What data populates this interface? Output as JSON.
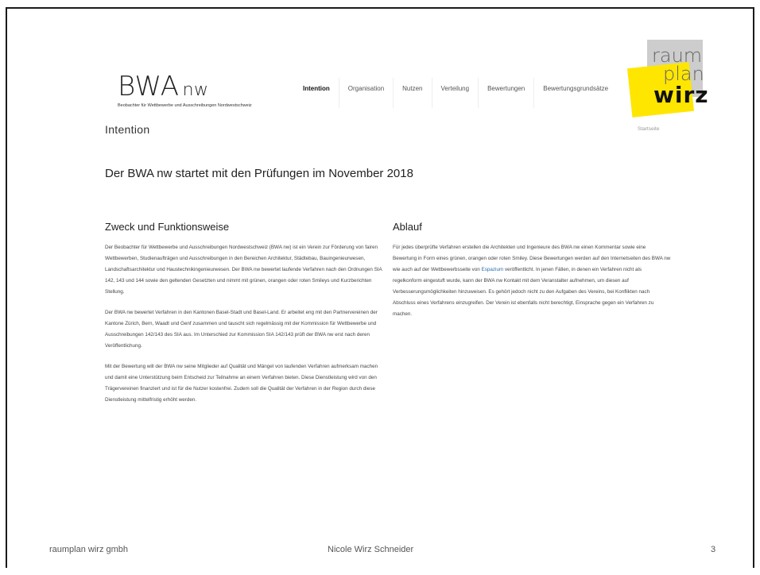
{
  "logo": {
    "main": "BWA",
    "suffix": "nw",
    "subtitle": "Beobachter für Wettbewerbe und Ausschreibungen Nordwestschweiz"
  },
  "nav": [
    {
      "label": "Intention",
      "active": true
    },
    {
      "label": "Organisation",
      "active": false
    },
    {
      "label": "Nutzen",
      "active": false
    },
    {
      "label": "Verteilung",
      "active": false
    },
    {
      "label": "Bewertungen",
      "active": false
    },
    {
      "label": "Bewertungsgrundsätze",
      "active": false
    }
  ],
  "brand_logo": {
    "line1": "raum",
    "line2": "plan",
    "line3": "wirz"
  },
  "page": {
    "title": "Intention",
    "home_link": "Startseite",
    "headline": "Der BWA nw startet mit den Prüfungen im November 2018"
  },
  "left": {
    "heading": "Zweck und Funktionsweise",
    "p1": "Der Beobachter für Wettbewerbe und Ausschreibungen Nordwestschweiz (BWA nw) ist ein Verein zur Förderung von fairen Wettbewerben, Studienaufträgen und Ausschreibungen in den Bereichen Architektur, Städtebau, Bauingenieurwesen, Landschaftsarchitektur und Haustechnikingenieurwesen. Der BWA nw bewertet laufende Verfahren nach den Ordnungen SIA 142, 143 und 144 sowie den geltenden Gesetzten und nimmt mit grünen, orangen oder roten Smileys und Kurzberichten Stellung.",
    "p2": "Der BWA nw bewertet Verfahren in den Kantonen Basel-Stadt und Basel-Land. Er arbeitet eng mit den Partnervereinen der Kantone Zürich, Bern, Waadt und Genf zusammen und tauscht sich regelmässig mit der Kommission für Wettbewerbe und Ausschreibungen 142/143 des SIA aus. Im Unterschied zur Kommission SIA 142/143 prüft der BWA nw erst nach deren Veröffentlichung.",
    "p3": "Mit der Bewertung will der BWA nw seine Mitglieder auf Qualität und Mängel von laufenden Verfahren aufmerksam machen und damit eine Unterstützung beim Entscheid zur Teilnahme an einem Verfahren bieten. Diese Dienstleistung wird von den Trägervereinen finanziert und ist für die Nutzer kostenfrei. Zudem soll die Qualität der Verfahren in der Region durch diese Dienstleistung mittelfristig erhöht werden."
  },
  "right": {
    "heading": "Ablauf",
    "p1_before": "Für jedes überprüfte Verfahren erstellen die Architekten und Ingenieure des BWA nw einen Kommentar sowie eine Bewertung in Form eines grünen, orangen oder roten Smiley. Diese Bewertungen werden auf den Internetseiten des BWA nw wie auch auf der Wettbewerbsseite von ",
    "p1_link": "Espazium",
    "p1_after": " veröffentlicht. In jenen Fällen, in denen ein Verfahren nicht als regelkonform eingestuft wurde, kann der BWA nw Kontakt mit dem Veranstalter aufnehmen, um diesen auf Verbesserungsmöglichkeiten hinzuweisen. Es gehört jedoch nicht zu den Aufgaben des Vereins, bei Konflikten nach Abschluss eines Verfahrens einzugreifen. Der Verein ist ebenfalls nicht berechtigt, Einsprache gegen ein Verfahren zu machen."
  },
  "footer": {
    "company": "raumplan wirz gmbh",
    "person": "Nicole Wirz Schneider",
    "page_number": "3"
  }
}
